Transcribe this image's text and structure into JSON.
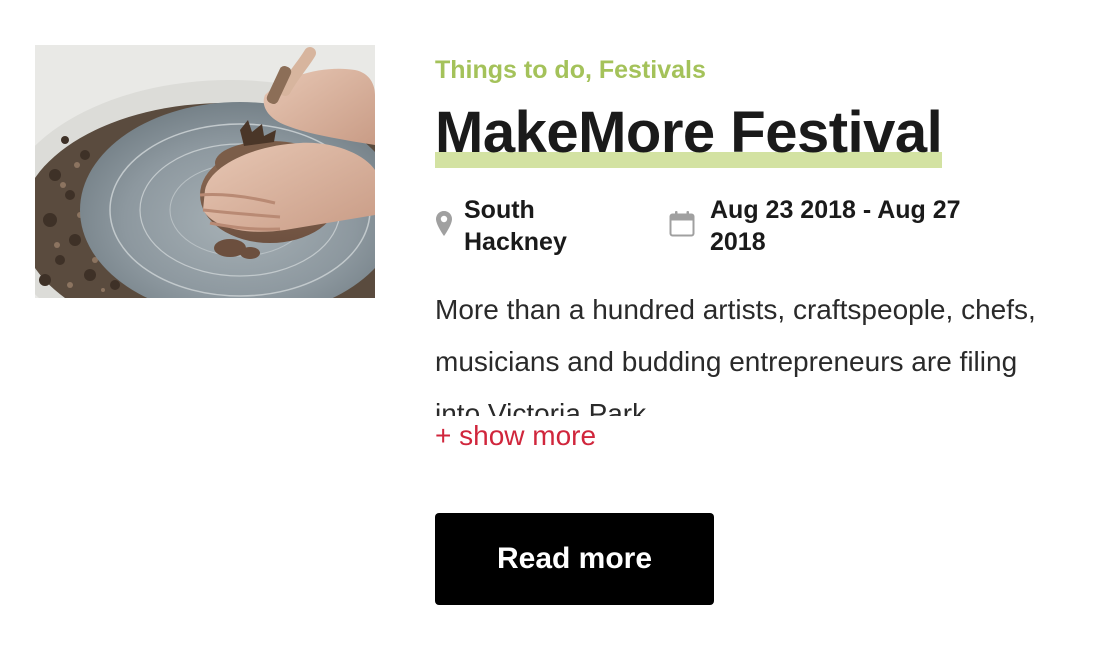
{
  "event": {
    "categories": "Things to do, Festivals",
    "title": "MakeMore Festival",
    "location_line1": "South",
    "location_line2": "Hackney",
    "date_line1": "Aug 23 2018 - Aug 27",
    "date_line2": "2018",
    "description": "More than a hundred artists, craftspeople, chefs, musicians and budding entrepreneurs are filing into Victoria Park",
    "show_more_label": "+ show more",
    "read_more_label": "Read more"
  },
  "image": {
    "subject": "pottery-wheel-hands-shaping-clay"
  },
  "icons": {
    "location": "map-pin-icon",
    "date": "calendar-icon"
  },
  "colors": {
    "category": "#a4c25a",
    "title_highlight": "#d3e2a2",
    "show_more": "#d0263c",
    "button_bg": "#000000",
    "button_text": "#ffffff",
    "icon": "#a0a0a0"
  }
}
